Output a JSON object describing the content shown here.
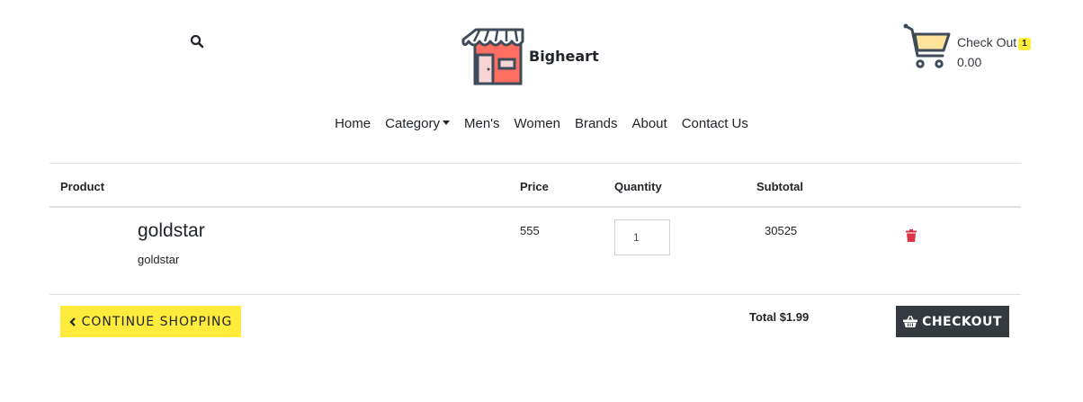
{
  "header": {
    "brand_name": "Bigheart",
    "cart": {
      "label": "Check Out",
      "count": "1",
      "amount": "0.00"
    }
  },
  "nav": {
    "items": [
      "Home",
      "Category",
      "Men's",
      "Women",
      "Brands",
      "About",
      "Contact Us"
    ]
  },
  "table": {
    "columns": [
      "Product",
      "Price",
      "Quantity",
      "Subtotal"
    ],
    "rows": [
      {
        "title": "goldstar",
        "subtitle": "goldstar",
        "price": "555",
        "quantity": "1",
        "subtotal": "30525"
      }
    ]
  },
  "footer": {
    "continue_label": "Continue Shopping",
    "total_label": "Total $1.99",
    "checkout_label": "Checkout"
  },
  "colors": {
    "accent_yellow": "#ffeb3b",
    "dark_button": "#343a40",
    "trash_red": "#dc3545",
    "logo_red": "#ff6f61"
  }
}
